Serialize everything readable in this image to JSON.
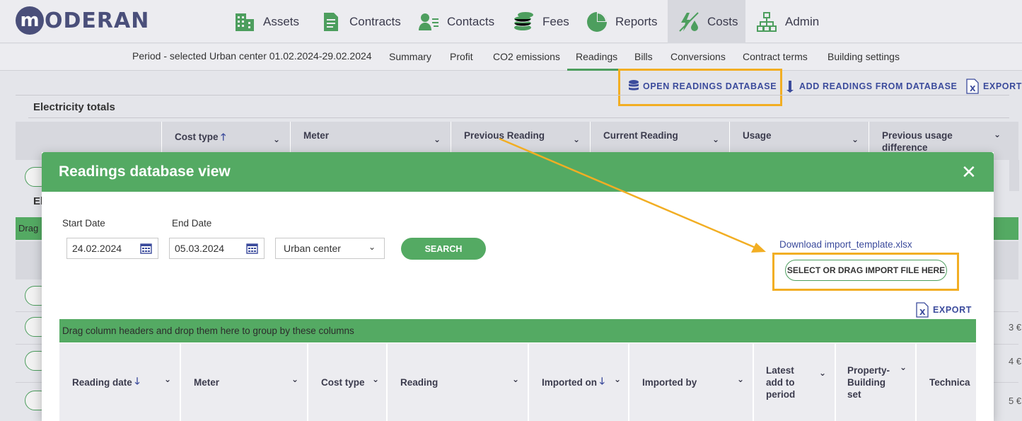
{
  "brand": {
    "logo_letter": "m",
    "logo_rest": "ODERAN"
  },
  "nav": [
    {
      "label": "Assets",
      "icon": "building-icon"
    },
    {
      "label": "Contracts",
      "icon": "document-icon"
    },
    {
      "label": "Contacts",
      "icon": "contacts-icon"
    },
    {
      "label": "Fees",
      "icon": "coins-icon"
    },
    {
      "label": "Reports",
      "icon": "pie-chart-icon"
    },
    {
      "label": "Costs",
      "icon": "utilities-icon",
      "active": true
    },
    {
      "label": "Admin",
      "icon": "org-chart-icon"
    }
  ],
  "subnav": {
    "period": "Period - selected Urban center 01.02.2024-29.02.2024",
    "tabs": [
      "Summary",
      "Profit",
      "CO2 emissions",
      "Readings",
      "Bills",
      "Conversions",
      "Contract terms",
      "Building settings"
    ],
    "active_tab": "Readings"
  },
  "actions": {
    "open_db": "OPEN READINGS DATABASE",
    "add_from_db": "ADD READINGS FROM DATABASE",
    "export": "EXPORT"
  },
  "background_table": {
    "section_title": "Electricity totals",
    "columns": [
      "Cost type",
      "Meter",
      "Previous Reading",
      "Current Reading",
      "Usage",
      "Previous usage difference"
    ],
    "second_section_fragment": "El",
    "drag_fragment": "Drag",
    "right_fragments": [
      "3 €",
      "4 €",
      "5 €"
    ]
  },
  "modal": {
    "title": "Readings database view",
    "start_date_label": "Start Date",
    "end_date_label": "End Date",
    "start_date": "24.02.2024",
    "end_date": "05.03.2024",
    "location": "Urban center",
    "search_label": "SEARCH",
    "download_link": "Download import_template.xlsx",
    "import_label": "SELECT OR DRAG IMPORT FILE HERE",
    "export_label": "EXPORT",
    "group_bar": "Drag column headers and drop them here to group by these columns",
    "columns": [
      "Reading date",
      "Meter",
      "Cost type",
      "Reading",
      "Imported on",
      "Imported by",
      "Latest add to period",
      "Property-Building set",
      "Technica"
    ]
  },
  "colors": {
    "accent_green": "#54aa63",
    "highlight": "#f2ae23",
    "link_blue": "#3b4b9c",
    "brand": "#4a4f7a"
  }
}
